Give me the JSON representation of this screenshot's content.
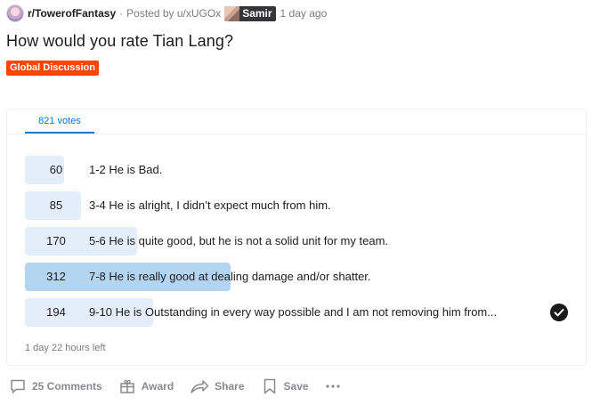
{
  "post": {
    "subreddit": "r/TowerofFantasy",
    "separator": "·",
    "posted_by": "Posted by u/xUGOx",
    "user_flair": "Samir",
    "time": "1 day ago",
    "title": "How would you rate Tian Lang?",
    "flair": "Global Discussion"
  },
  "poll": {
    "tab_label": "821 votes",
    "total_votes": 821,
    "options": [
      {
        "count": "60",
        "votes": 60,
        "label": "1-2 He is Bad.",
        "winner": false,
        "selected": false
      },
      {
        "count": "85",
        "votes": 85,
        "label": "3-4 He is alright, I didn’t expect much from him.",
        "winner": false,
        "selected": false
      },
      {
        "count": "170",
        "votes": 170,
        "label": "5-6 He is quite good, but he is not a solid unit for my team.",
        "winner": false,
        "selected": false
      },
      {
        "count": "312",
        "votes": 312,
        "label": "7-8 He is really good at dealing damage and/or shatter.",
        "winner": true,
        "selected": false
      },
      {
        "count": "194",
        "votes": 194,
        "label": "9-10 He is Outstanding in every way possible and I am not removing him from...",
        "winner": false,
        "selected": true
      }
    ],
    "time_left": "1 day 22 hours left"
  },
  "actions": {
    "comments": "25 Comments",
    "award": "Award",
    "share": "Share",
    "save": "Save",
    "more_icon": "more-icon"
  },
  "colors": {
    "accent": "#0079d3",
    "flair_bg": "#ff4500",
    "bar": "#e3eefa",
    "bar_winner": "#b3d5f2"
  }
}
